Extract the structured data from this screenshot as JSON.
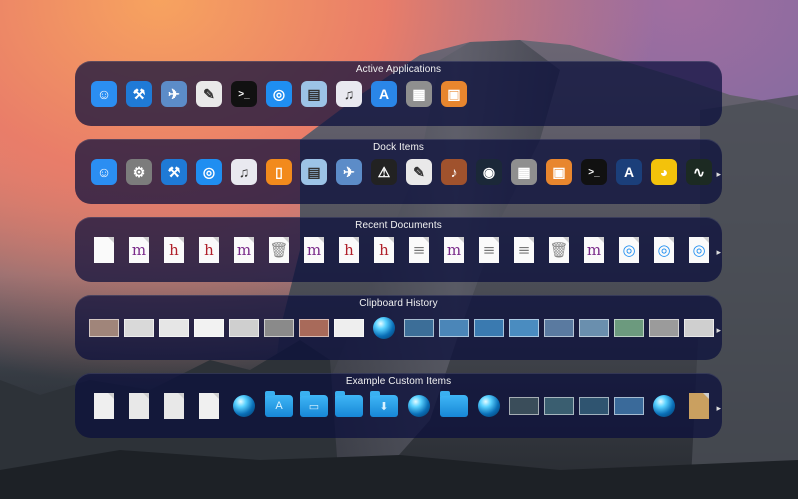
{
  "panels": [
    {
      "title": "Active Applications",
      "items": [
        {
          "icon": "finder-icon",
          "glyph": "☺",
          "bg": "#2b8ef2"
        },
        {
          "icon": "xcode-icon",
          "glyph": "⚒",
          "bg": "#1f7ad6"
        },
        {
          "icon": "preview-bird-icon",
          "glyph": "✈",
          "bg": "#5c8cc8"
        },
        {
          "icon": "textedit-icon",
          "glyph": "✎",
          "bg": "#e9e9e9"
        },
        {
          "icon": "terminal-icon",
          "glyph": ">_",
          "bg": "#111111"
        },
        {
          "icon": "safari-icon",
          "glyph": "◎",
          "bg": "#1f8ef1"
        },
        {
          "icon": "preview-icon",
          "glyph": "▤",
          "bg": "#9cc3e6"
        },
        {
          "icon": "itunes-icon",
          "glyph": "♫",
          "bg": "#e9e9f0"
        },
        {
          "icon": "app-store-icon",
          "glyph": "A",
          "bg": "#2a86e8"
        },
        {
          "icon": "calculator-icon",
          "glyph": "▦",
          "bg": "#8f8f8f"
        },
        {
          "icon": "photos-icon",
          "glyph": "▣",
          "bg": "#e8862e"
        }
      ]
    },
    {
      "title": "Dock Items",
      "items": [
        {
          "icon": "finder-icon",
          "glyph": "☺",
          "bg": "#2b8ef2"
        },
        {
          "icon": "system-preferences-icon",
          "glyph": "⚙",
          "bg": "#7c7c7c"
        },
        {
          "icon": "xcode-icon",
          "glyph": "⚒",
          "bg": "#1f7ad6"
        },
        {
          "icon": "safari-icon",
          "glyph": "◎",
          "bg": "#1f8ef1"
        },
        {
          "icon": "itunes-icon",
          "glyph": "♫",
          "bg": "#e9e9f0"
        },
        {
          "icon": "ibooks-icon",
          "glyph": "▯",
          "bg": "#f28a1c"
        },
        {
          "icon": "preview-icon",
          "glyph": "▤",
          "bg": "#9cc3e6"
        },
        {
          "icon": "preview-bird-icon",
          "glyph": "✈",
          "bg": "#5c8cc8"
        },
        {
          "icon": "console-icon",
          "glyph": "⚠",
          "bg": "#222222"
        },
        {
          "icon": "textedit-icon",
          "glyph": "✎",
          "bg": "#e9e9e9"
        },
        {
          "icon": "garageband-icon",
          "glyph": "♪",
          "bg": "#a0522d"
        },
        {
          "icon": "steam-icon",
          "glyph": "◉",
          "bg": "#1b2838"
        },
        {
          "icon": "calculator-icon",
          "glyph": "▦",
          "bg": "#8f8f8f"
        },
        {
          "icon": "photos-icon",
          "glyph": "▣",
          "bg": "#e8862e"
        },
        {
          "icon": "terminal-icon",
          "glyph": ">_",
          "bg": "#111111"
        },
        {
          "icon": "instruments-icon",
          "glyph": "A",
          "bg": "#1b3f7a"
        },
        {
          "icon": "cyberduck-icon",
          "glyph": "◕",
          "bg": "#f3c20b"
        },
        {
          "icon": "activity-monitor-icon",
          "glyph": "∿",
          "bg": "#1c2a22"
        }
      ]
    },
    {
      "title": "Recent Documents",
      "items": [
        {
          "icon": "blank-document-icon",
          "glyph": ""
        },
        {
          "icon": "m-document-icon",
          "glyph": "m",
          "color": "#7a2a8a"
        },
        {
          "icon": "h-document-icon",
          "glyph": "h",
          "color": "#b0202a"
        },
        {
          "icon": "h-document-icon",
          "glyph": "h",
          "color": "#b0202a"
        },
        {
          "icon": "m-document-icon",
          "glyph": "m",
          "color": "#7a2a8a"
        },
        {
          "icon": "trash-icon",
          "glyph": "🗑",
          "color": "#888"
        },
        {
          "icon": "m-document-icon",
          "glyph": "m",
          "color": "#7a2a8a"
        },
        {
          "icon": "h-document-icon",
          "glyph": "h",
          "color": "#b0202a"
        },
        {
          "icon": "h-document-icon",
          "glyph": "h",
          "color": "#b0202a"
        },
        {
          "icon": "text-document-icon",
          "glyph": "≡",
          "color": "#777"
        },
        {
          "icon": "m-document-icon",
          "glyph": "m",
          "color": "#7a2a8a"
        },
        {
          "icon": "text-document-icon",
          "glyph": "≡",
          "color": "#777"
        },
        {
          "icon": "text-document-icon",
          "glyph": "≡",
          "color": "#777"
        },
        {
          "icon": "trash-icon",
          "glyph": "🗑",
          "color": "#888"
        },
        {
          "icon": "m-document-icon",
          "glyph": "m",
          "color": "#7a2a8a"
        },
        {
          "icon": "html-document-icon",
          "glyph": "◎",
          "color": "#1f8ef1"
        },
        {
          "icon": "html-document-icon",
          "glyph": "◎",
          "color": "#1f8ef1"
        },
        {
          "icon": "html-document-icon",
          "glyph": "◎",
          "color": "#1f8ef1"
        }
      ]
    },
    {
      "title": "Clipboard History",
      "items": [
        {
          "icon": "clipboard-image-icon",
          "fill": "#a0857a"
        },
        {
          "icon": "clipboard-image-icon",
          "fill": "#d9d9d9"
        },
        {
          "icon": "clipboard-image-icon",
          "fill": "#e6e6e6"
        },
        {
          "icon": "clipboard-image-icon",
          "fill": "#f2f2f2"
        },
        {
          "icon": "clipboard-image-icon",
          "fill": "#cfcfcf"
        },
        {
          "icon": "clipboard-image-icon",
          "fill": "#8a8a8a"
        },
        {
          "icon": "clipboard-image-icon",
          "fill": "#a86a5a"
        },
        {
          "icon": "clipboard-image-icon",
          "fill": "#eeeeee"
        },
        {
          "icon": "clipboard-link-icon",
          "orb": true
        },
        {
          "icon": "clipboard-image-icon",
          "fill": "#3c6e98"
        },
        {
          "icon": "clipboard-image-icon",
          "fill": "#4b86b8"
        },
        {
          "icon": "clipboard-image-icon",
          "fill": "#3a7ab0"
        },
        {
          "icon": "clipboard-image-icon",
          "fill": "#4a8cc0"
        },
        {
          "icon": "clipboard-image-icon",
          "fill": "#5a7aa0"
        },
        {
          "icon": "clipboard-image-icon",
          "fill": "#6a8fae"
        },
        {
          "icon": "clipboard-image-icon",
          "fill": "#6c9a7e"
        },
        {
          "icon": "clipboard-image-icon",
          "fill": "#9b9b9b"
        },
        {
          "icon": "clipboard-image-icon",
          "fill": "#cfcfcf"
        }
      ]
    },
    {
      "title": "Example Custom Items",
      "items": [
        {
          "icon": "screenshot-document-icon",
          "fill": "#efefef"
        },
        {
          "icon": "screenshot-document-icon",
          "fill": "#e8e8e8"
        },
        {
          "icon": "screenshot-document-icon",
          "fill": "#e8e8e8"
        },
        {
          "icon": "screenshot-document-icon",
          "fill": "#f0f0f0"
        },
        {
          "icon": "sphere-icon",
          "orb": true
        },
        {
          "icon": "folder-icon",
          "folder": "A"
        },
        {
          "icon": "folder-icon",
          "folder": "▭"
        },
        {
          "icon": "folder-icon",
          "folder": ""
        },
        {
          "icon": "downloads-folder-icon",
          "folder": "⬇"
        },
        {
          "icon": "sphere-icon",
          "orb": true
        },
        {
          "icon": "folder-icon",
          "folder": ""
        },
        {
          "icon": "sphere-icon",
          "orb": true
        },
        {
          "icon": "window-thumbnail-icon",
          "fill": "#3a4d5a"
        },
        {
          "icon": "window-thumbnail-icon",
          "fill": "#3a5e70"
        },
        {
          "icon": "window-thumbnail-icon",
          "fill": "#2f5470"
        },
        {
          "icon": "wallpaper-thumbnail-icon",
          "fill": "#3a6a9a"
        },
        {
          "icon": "sphere-icon",
          "orb": true
        },
        {
          "icon": "note-document-icon",
          "fill": "#caa060"
        }
      ]
    }
  ],
  "overflow_glyph": "▸"
}
